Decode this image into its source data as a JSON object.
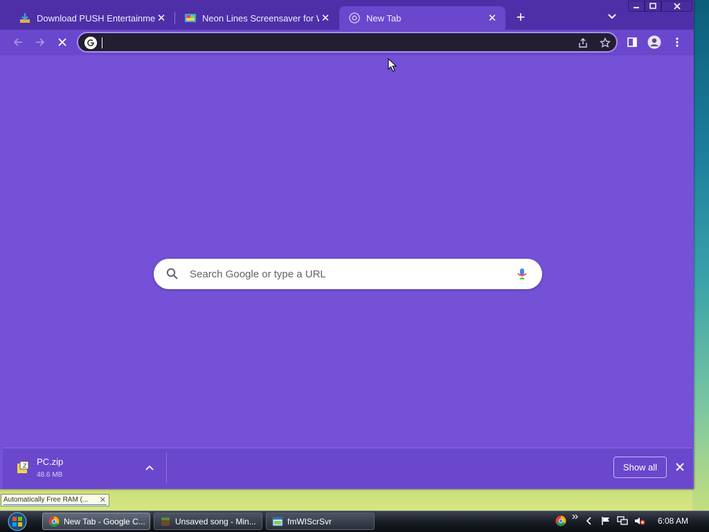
{
  "tabs": [
    {
      "title": "Download PUSH Entertainment -",
      "active": false
    },
    {
      "title": "Neon Lines Screensaver for Wind",
      "active": false
    },
    {
      "title": "New Tab",
      "active": true
    }
  ],
  "omnibox": {
    "value": "",
    "placeholder": ""
  },
  "ntp": {
    "search_placeholder": "Search Google or type a URL"
  },
  "download": {
    "filename": "PC.zip",
    "size": "48.6 MB",
    "show_all_label": "Show all"
  },
  "tooltip": {
    "text": "Automatically Free RAM (..."
  },
  "taskbar": {
    "tasks": [
      {
        "label": "New Tab - Google C...",
        "active": true
      },
      {
        "label": "Unsaved song - Min...",
        "active": false
      },
      {
        "label": "fmWIScrSvr",
        "active": false
      }
    ],
    "clock": "6:08 AM"
  },
  "colors": {
    "tabstrip": "#4e2fa8",
    "toolbar": "#6a47cc",
    "content_background": "#7451d6",
    "omnibox_background": "#241e33"
  },
  "icons": {
    "back": "arrow-left-icon",
    "forward": "arrow-right-icon",
    "stop": "stop-loading-icon",
    "share": "share-icon",
    "bookmark": "star-icon",
    "side_panel": "side-panel-icon",
    "profile": "profile-icon",
    "menu": "kebab-menu-icon"
  }
}
